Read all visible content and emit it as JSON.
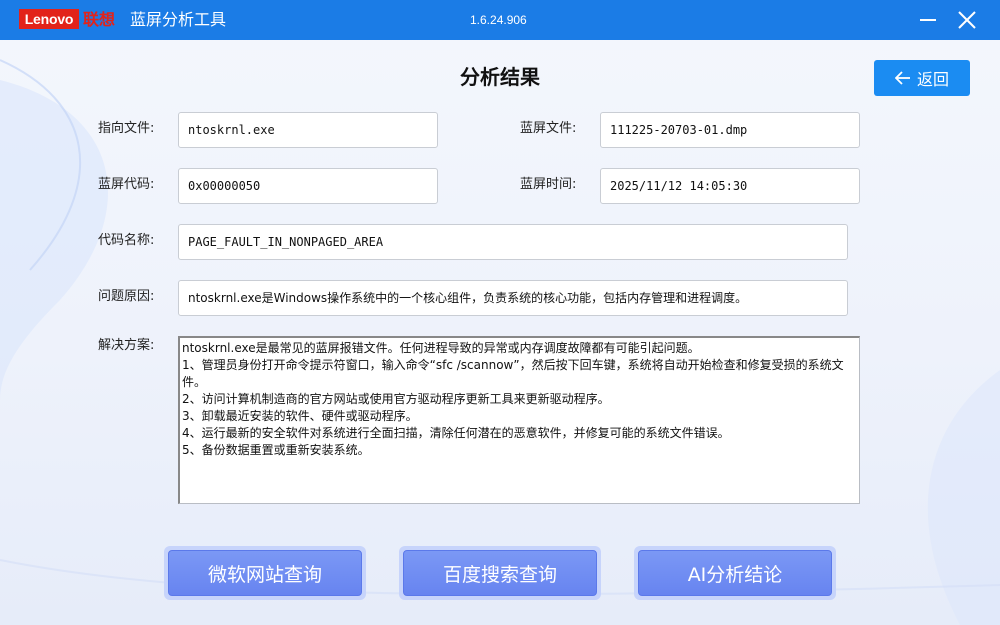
{
  "titlebar": {
    "logo_text": "Lenovo",
    "logo_cn": "联想",
    "app_title": "蓝屏分析工具",
    "version": "1.6.24.906",
    "brand_color": "#e2231a",
    "bar_color": "#1b7ce6",
    "minimize_icon": "minimize-icon",
    "close_icon": "close-icon"
  },
  "main": {
    "title": "分析结果",
    "back_label": "返回",
    "back_icon": "arrow-left-icon",
    "fields": {
      "target_file_label": "指向文件:",
      "target_file_value": "ntoskrnl.exe",
      "dump_file_label": "蓝屏文件:",
      "dump_file_value": "111225-20703-01.dmp",
      "bsod_code_label": "蓝屏代码:",
      "bsod_code_value": "0x00000050",
      "bsod_time_label": "蓝屏时间:",
      "bsod_time_value": "2025/11/12 14:05:30",
      "code_name_label": "代码名称:",
      "code_name_value": "PAGE_FAULT_IN_NONPAGED_AREA",
      "cause_label": "问题原因:",
      "cause_value": "ntoskrnl.exe是Windows操作系统中的一个核心组件，负责系统的核心功能，包括内存管理和进程调度。",
      "solution_label": "解决方案:"
    },
    "solution_lines": [
      "ntoskrnl.exe是最常见的蓝屏报错文件。任何进程导致的异常或内存调度故障都有可能引起问题。",
      "1、管理员身份打开命令提示符窗口，输入命令“sfc /scannow”，然后按下回车键，系统将自动开始检查和修复受损的系统文件。",
      "2、访问计算机制造商的官方网站或使用官方驱动程序更新工具来更新驱动程序。",
      "3、卸载最近安装的软件、硬件或驱动程序。",
      "4、运行最新的安全软件对系统进行全面扫描，清除任何潜在的恶意软件，并修复可能的系统文件错误。",
      "5、备份数据重置或重新安装系统。"
    ]
  },
  "actions": {
    "microsoft_label": "微软网站查询",
    "baidu_label": "百度搜索查询",
    "ai_label": "AI分析结论",
    "button_color": "#6d8af2"
  }
}
